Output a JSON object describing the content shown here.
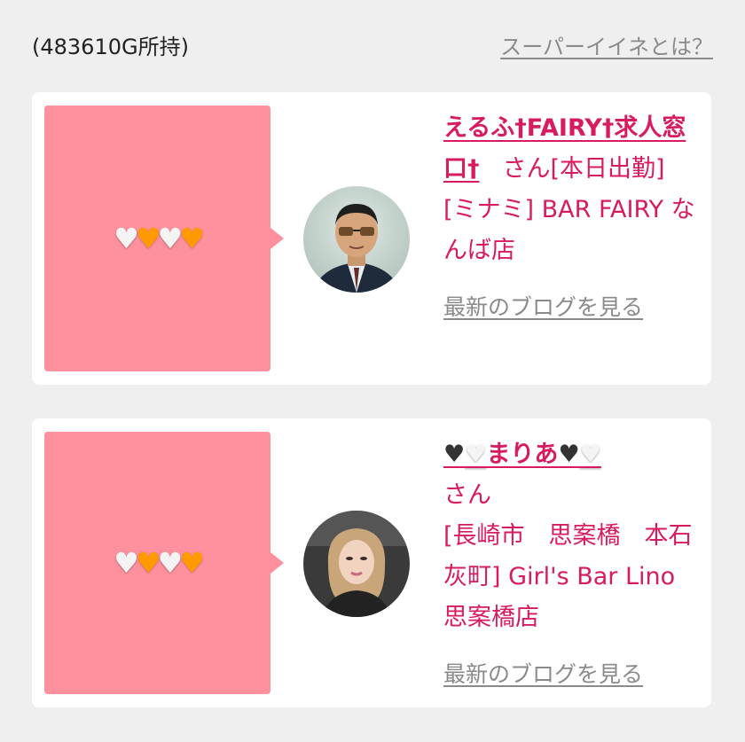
{
  "header": {
    "points_text": "(483610G所持)",
    "super_like_link": "スーパーイイネとは？"
  },
  "cards": [
    {
      "hearts": [
        "white",
        "orange",
        "white",
        "orange"
      ],
      "name": "えるふ†FAIRY†求人窓口†",
      "suffix": "さん[本日出勤]",
      "shop": "[ミナミ] BAR FAIRY なんば店",
      "blog_link": "最新のブログを見る"
    },
    {
      "hearts": [
        "white",
        "orange",
        "white",
        "orange"
      ],
      "name_hearts_prefix": [
        "black",
        "white"
      ],
      "name": "まりあ",
      "name_hearts_suffix": [
        "black",
        "white"
      ],
      "suffix": "さん",
      "shop": "[長崎市　思案橋　本石灰町] Girl's Bar Lino 思案橋店",
      "blog_link": "最新のブログを見る"
    }
  ],
  "icons": {
    "heart": "♥"
  },
  "colors": {
    "bubble": "#ff919e",
    "accent": "#d81b60",
    "background": "#efefef"
  }
}
